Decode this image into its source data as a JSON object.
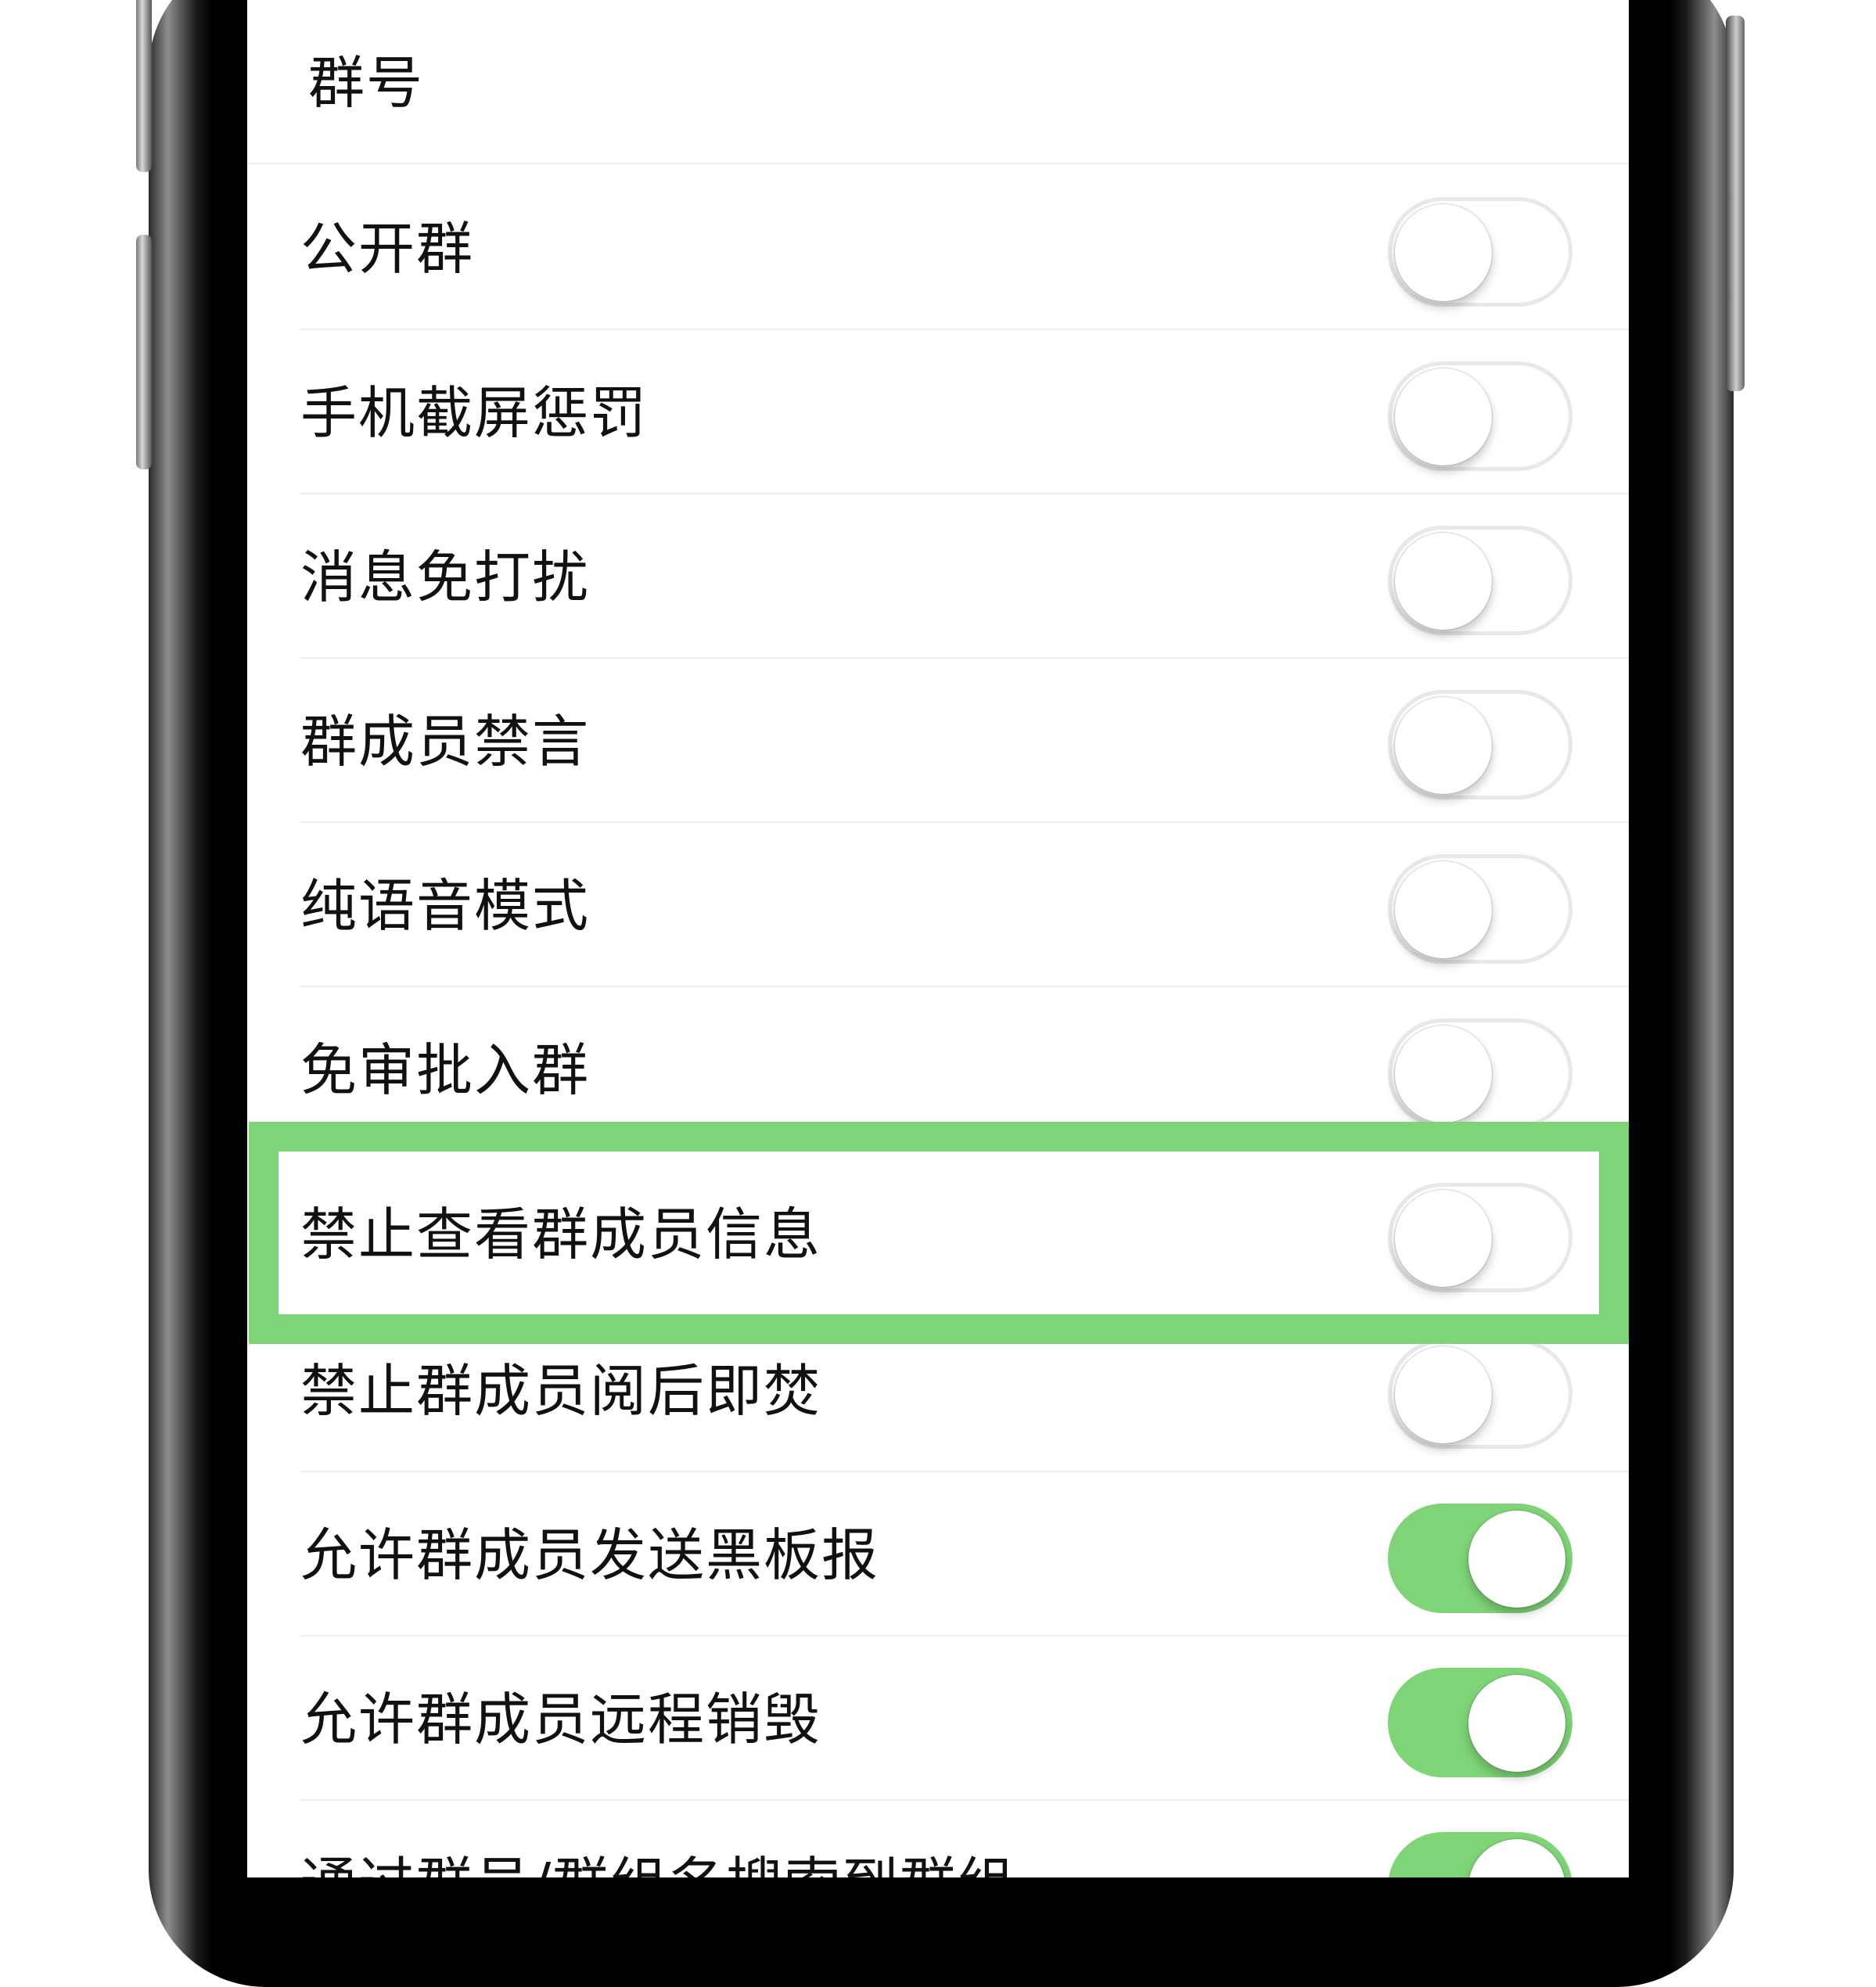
{
  "settings": {
    "rows": [
      {
        "label": "群号",
        "has_toggle": false
      },
      {
        "label": "公开群",
        "has_toggle": true,
        "on": false
      },
      {
        "label": "手机截屏惩罚",
        "has_toggle": true,
        "on": false
      },
      {
        "label": "消息免打扰",
        "has_toggle": true,
        "on": false
      },
      {
        "label": "群成员禁言",
        "has_toggle": true,
        "on": false
      },
      {
        "label": "纯语音模式",
        "has_toggle": true,
        "on": false
      },
      {
        "label": "免审批入群",
        "has_toggle": true,
        "on": false
      },
      {
        "label": "禁止查看群成员信息",
        "has_toggle": true,
        "on": false,
        "highlighted": true
      },
      {
        "label": "禁止群成员阅后即焚",
        "has_toggle": true,
        "on": false
      },
      {
        "label": "允许群成员发送黑板报",
        "has_toggle": true,
        "on": true
      },
      {
        "label": "允许群成员远程销毁",
        "has_toggle": true,
        "on": true
      },
      {
        "label": "通过群号/群组名搜索到群组",
        "has_toggle": true,
        "on": true
      }
    ]
  },
  "colors": {
    "toggle_on": "#7ed477",
    "highlight_border": "#7ed477",
    "toggle_off_border": "#e8e8e8"
  }
}
